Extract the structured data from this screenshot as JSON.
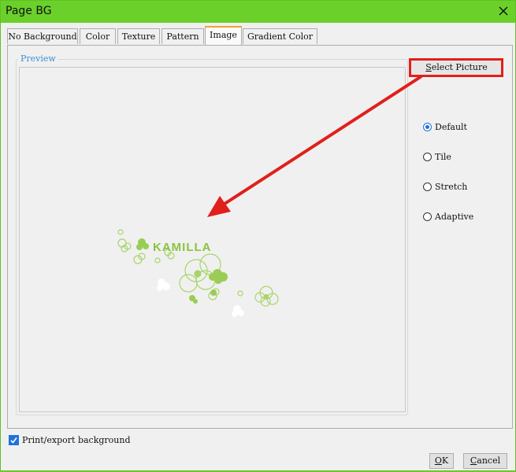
{
  "window": {
    "title": "Page BG"
  },
  "tabs": [
    {
      "label": "No Background"
    },
    {
      "label": "Color"
    },
    {
      "label": "Texture"
    },
    {
      "label": "Pattern"
    },
    {
      "label": "Image"
    },
    {
      "label": "Gradient Color"
    }
  ],
  "active_tab": "Image",
  "preview": {
    "legend": "Preview",
    "image_text": "KAMILLA"
  },
  "select_picture": {
    "label_accel": "S",
    "label_rest": "elect Picture"
  },
  "fit_options": [
    {
      "label": "Default",
      "checked": true
    },
    {
      "label": "Tile",
      "checked": false
    },
    {
      "label": "Stretch",
      "checked": false
    },
    {
      "label": "Adaptive",
      "checked": false
    }
  ],
  "print_export": {
    "label": "Print/export background",
    "checked": true
  },
  "ok_button": {
    "accel": "O",
    "rest": "K"
  },
  "cancel_button": {
    "accel": "C",
    "rest": "ancel"
  },
  "colors": {
    "titlebar": "#6bd12a",
    "accent": "#1e73d8",
    "annotation": "#e0201b",
    "flower": "#8ac43e"
  }
}
